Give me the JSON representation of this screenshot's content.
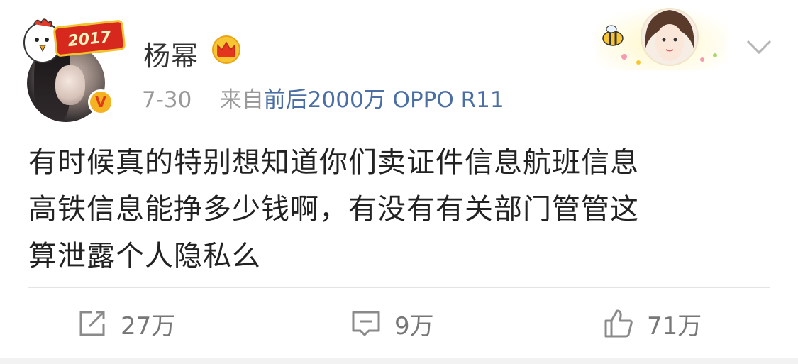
{
  "post": {
    "author": "杨幂",
    "timestamp": "7-30",
    "source_prefix": "来自",
    "source": "前后2000万 OPPO R11",
    "avatar_badge_text": "2017",
    "content_lines": [
      "有时候真的特别想知道你们卖证件信息航班信息",
      "高铁信息能挣多少钱啊，有没有有关部门管管这",
      "算泄露个人隐私么"
    ]
  },
  "actions": {
    "repost_count": "27万",
    "comment_count": "9万",
    "like_count": "71万"
  },
  "icons": {
    "verified": "verified-badge-icon",
    "vip": "crown-icon",
    "menu": "chevron-down-icon",
    "repost": "repost-icon",
    "comment": "comment-icon",
    "like": "thumbs-up-icon"
  },
  "colors": {
    "source_link": "#4b6fa5",
    "meta_gray": "#9a9a9a",
    "text": "#222222",
    "verified_gold": "#f6b321"
  }
}
